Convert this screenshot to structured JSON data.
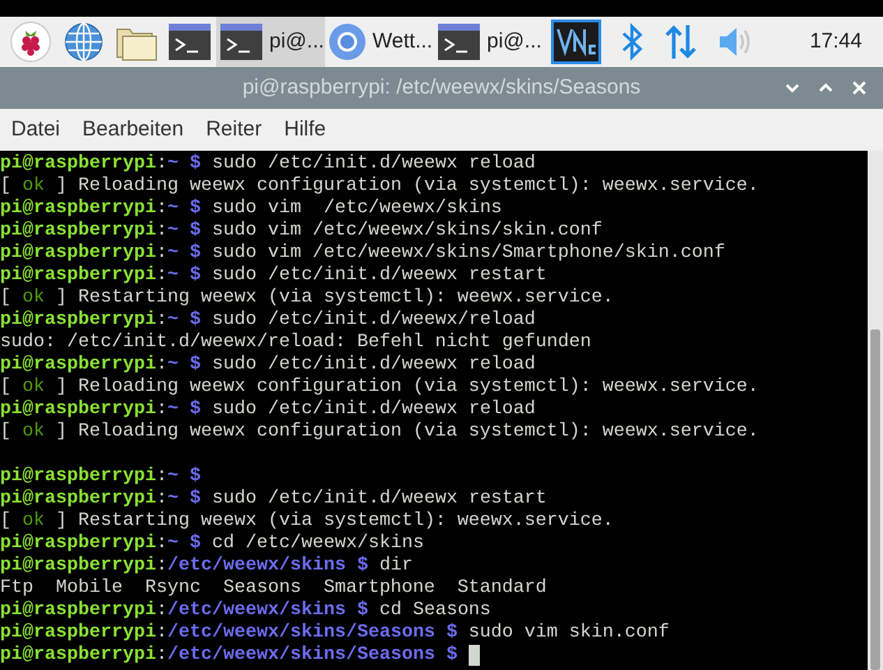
{
  "taskbar": {
    "launchers": [
      {
        "kind": "raspberry"
      },
      {
        "kind": "globe"
      },
      {
        "kind": "folder"
      },
      {
        "kind": "terminal"
      }
    ],
    "tasks": [
      {
        "kind": "terminal",
        "label": "pi@...",
        "selected": true
      },
      {
        "kind": "browser",
        "label": "Wett...",
        "selected": false
      },
      {
        "kind": "terminal",
        "label": "pi@...",
        "selected": false
      }
    ],
    "tray": [
      {
        "kind": "vnc"
      },
      {
        "kind": "bluetooth"
      },
      {
        "kind": "network"
      },
      {
        "kind": "volume"
      }
    ],
    "clock": "17:44"
  },
  "window": {
    "title": "pi@raspberrypi: /etc/weewx/skins/Seasons",
    "controls": [
      {
        "kind": "minimize"
      },
      {
        "kind": "maximize"
      },
      {
        "kind": "close"
      }
    ]
  },
  "menu": [
    "Datei",
    "Bearbeiten",
    "Reiter",
    "Hilfe"
  ],
  "terminal": {
    "lines": [
      {
        "kind": "text",
        "segments": [
          {
            "kind": "user",
            "text": "pi@raspberrypi"
          },
          {
            "kind": "plain",
            "text": ":"
          },
          {
            "kind": "path",
            "text": "~ $"
          },
          {
            "kind": "plain",
            "text": " sudo /etc/init.d/weewx reload"
          }
        ]
      },
      {
        "kind": "text",
        "segments": [
          {
            "kind": "plain",
            "text": "[ "
          },
          {
            "kind": "ok",
            "text": "ok"
          },
          {
            "kind": "plain",
            "text": " ] Reloading weewx configuration (via systemctl): weewx.service."
          }
        ]
      },
      {
        "kind": "text",
        "segments": [
          {
            "kind": "user",
            "text": "pi@raspberrypi"
          },
          {
            "kind": "plain",
            "text": ":"
          },
          {
            "kind": "path",
            "text": "~ $"
          },
          {
            "kind": "plain",
            "text": " sudo vim  /etc/weewx/skins"
          }
        ]
      },
      {
        "kind": "text",
        "segments": [
          {
            "kind": "user",
            "text": "pi@raspberrypi"
          },
          {
            "kind": "plain",
            "text": ":"
          },
          {
            "kind": "path",
            "text": "~ $"
          },
          {
            "kind": "plain",
            "text": " sudo vim /etc/weewx/skins/skin.conf"
          }
        ]
      },
      {
        "kind": "text",
        "segments": [
          {
            "kind": "user",
            "text": "pi@raspberrypi"
          },
          {
            "kind": "plain",
            "text": ":"
          },
          {
            "kind": "path",
            "text": "~ $"
          },
          {
            "kind": "plain",
            "text": " sudo vim /etc/weewx/skins/Smartphone/skin.conf"
          }
        ]
      },
      {
        "kind": "text",
        "segments": [
          {
            "kind": "user",
            "text": "pi@raspberrypi"
          },
          {
            "kind": "plain",
            "text": ":"
          },
          {
            "kind": "path",
            "text": "~ $"
          },
          {
            "kind": "plain",
            "text": " sudo /etc/init.d/weewx restart"
          }
        ]
      },
      {
        "kind": "text",
        "segments": [
          {
            "kind": "plain",
            "text": "[ "
          },
          {
            "kind": "ok",
            "text": "ok"
          },
          {
            "kind": "plain",
            "text": " ] Restarting weewx (via systemctl): weewx.service."
          }
        ]
      },
      {
        "kind": "text",
        "segments": [
          {
            "kind": "user",
            "text": "pi@raspberrypi"
          },
          {
            "kind": "plain",
            "text": ":"
          },
          {
            "kind": "path",
            "text": "~ $"
          },
          {
            "kind": "plain",
            "text": " sudo /etc/init.d/weewx/reload"
          }
        ]
      },
      {
        "kind": "text",
        "segments": [
          {
            "kind": "plain",
            "text": "sudo: /etc/init.d/weewx/reload: Befehl nicht gefunden"
          }
        ]
      },
      {
        "kind": "text",
        "segments": [
          {
            "kind": "user",
            "text": "pi@raspberrypi"
          },
          {
            "kind": "plain",
            "text": ":"
          },
          {
            "kind": "path",
            "text": "~ $"
          },
          {
            "kind": "plain",
            "text": " sudo /etc/init.d/weewx reload"
          }
        ]
      },
      {
        "kind": "text",
        "segments": [
          {
            "kind": "plain",
            "text": "[ "
          },
          {
            "kind": "ok",
            "text": "ok"
          },
          {
            "kind": "plain",
            "text": " ] Reloading weewx configuration (via systemctl): weewx.service."
          }
        ]
      },
      {
        "kind": "text",
        "segments": [
          {
            "kind": "user",
            "text": "pi@raspberrypi"
          },
          {
            "kind": "plain",
            "text": ":"
          },
          {
            "kind": "path",
            "text": "~ $"
          },
          {
            "kind": "plain",
            "text": " sudo /etc/init.d/weewx reload"
          }
        ]
      },
      {
        "kind": "text",
        "segments": [
          {
            "kind": "plain",
            "text": "[ "
          },
          {
            "kind": "ok",
            "text": "ok"
          },
          {
            "kind": "plain",
            "text": " ] Reloading weewx configuration (via systemctl): weewx.service."
          }
        ]
      },
      {
        "kind": "blank"
      },
      {
        "kind": "text",
        "segments": [
          {
            "kind": "user",
            "text": "pi@raspberrypi"
          },
          {
            "kind": "plain",
            "text": ":"
          },
          {
            "kind": "path",
            "text": "~ $"
          }
        ]
      },
      {
        "kind": "text",
        "segments": [
          {
            "kind": "user",
            "text": "pi@raspberrypi"
          },
          {
            "kind": "plain",
            "text": ":"
          },
          {
            "kind": "path",
            "text": "~ $"
          },
          {
            "kind": "plain",
            "text": " sudo /etc/init.d/weewx restart"
          }
        ]
      },
      {
        "kind": "text",
        "segments": [
          {
            "kind": "plain",
            "text": "[ "
          },
          {
            "kind": "ok",
            "text": "ok"
          },
          {
            "kind": "plain",
            "text": " ] Restarting weewx (via systemctl): weewx.service."
          }
        ]
      },
      {
        "kind": "text",
        "segments": [
          {
            "kind": "user",
            "text": "pi@raspberrypi"
          },
          {
            "kind": "plain",
            "text": ":"
          },
          {
            "kind": "path",
            "text": "~ $"
          },
          {
            "kind": "plain",
            "text": " cd /etc/weewx/skins"
          }
        ]
      },
      {
        "kind": "text",
        "segments": [
          {
            "kind": "user",
            "text": "pi@raspberrypi"
          },
          {
            "kind": "plain",
            "text": ":"
          },
          {
            "kind": "path",
            "text": "/etc/weewx/skins $"
          },
          {
            "kind": "plain",
            "text": " dir"
          }
        ]
      },
      {
        "kind": "text",
        "segments": [
          {
            "kind": "plain",
            "text": "Ftp  Mobile  Rsync  Seasons  Smartphone  Standard"
          }
        ]
      },
      {
        "kind": "text",
        "segments": [
          {
            "kind": "user",
            "text": "pi@raspberrypi"
          },
          {
            "kind": "plain",
            "text": ":"
          },
          {
            "kind": "path",
            "text": "/etc/weewx/skins $"
          },
          {
            "kind": "plain",
            "text": " cd Seasons"
          }
        ]
      },
      {
        "kind": "text",
        "segments": [
          {
            "kind": "user",
            "text": "pi@raspberrypi"
          },
          {
            "kind": "plain",
            "text": ":"
          },
          {
            "kind": "path",
            "text": "/etc/weewx/skins/Seasons $"
          },
          {
            "kind": "plain",
            "text": " sudo vim skin.conf"
          }
        ]
      },
      {
        "kind": "text",
        "cursor": true,
        "segments": [
          {
            "kind": "user",
            "text": "pi@raspberrypi"
          },
          {
            "kind": "plain",
            "text": ":"
          },
          {
            "kind": "path",
            "text": "/etc/weewx/skins/Seasons $"
          }
        ]
      }
    ]
  }
}
